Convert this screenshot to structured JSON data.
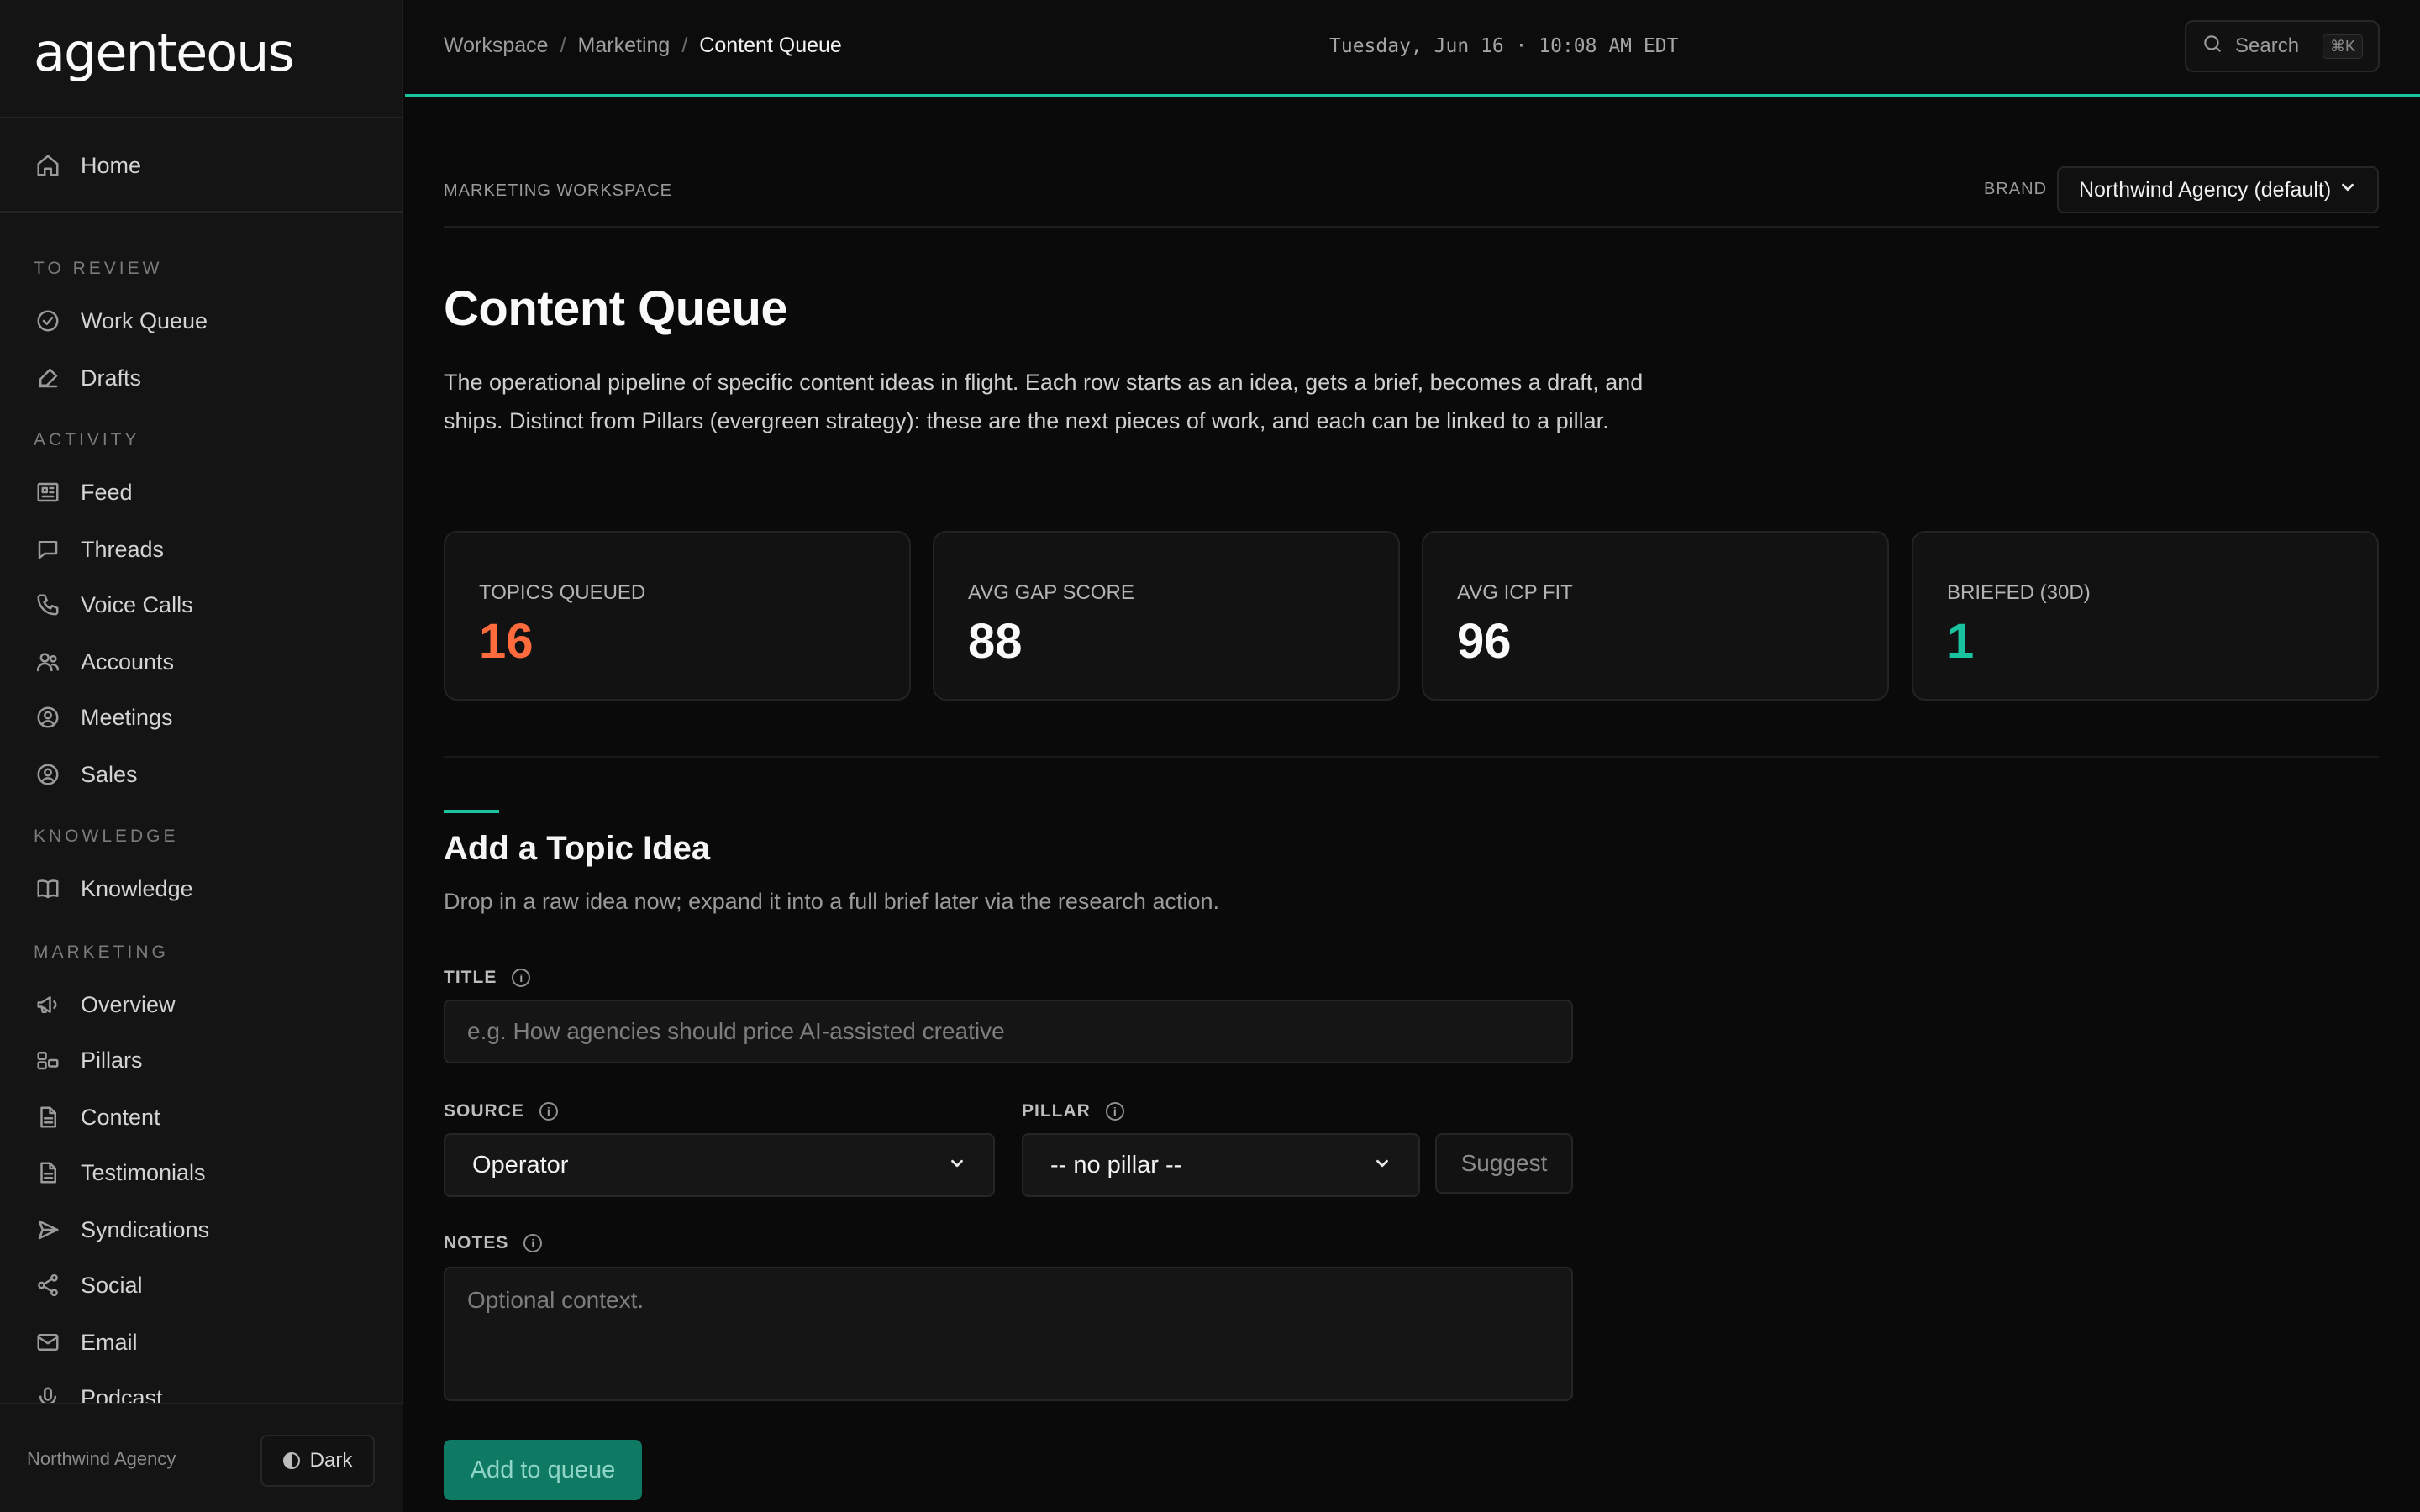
{
  "app": {
    "logo": "agenteous"
  },
  "colors": {
    "accent": "#19c3a0",
    "topics_value": "#ff6b3d",
    "briefed_value": "#19c3a0"
  },
  "sidebar": {
    "home": {
      "label": "Home",
      "icon": "home-icon"
    },
    "sections": [
      {
        "label": "TO REVIEW",
        "items": [
          {
            "label": "Work Queue",
            "icon": "check-circle-icon"
          },
          {
            "label": "Drafts",
            "icon": "edit-icon"
          }
        ]
      },
      {
        "label": "ACTIVITY",
        "items": [
          {
            "label": "Feed",
            "icon": "newspaper-icon"
          },
          {
            "label": "Threads",
            "icon": "chat-icon"
          },
          {
            "label": "Voice Calls",
            "icon": "phone-icon"
          },
          {
            "label": "Accounts",
            "icon": "users-icon"
          },
          {
            "label": "Meetings",
            "icon": "user-circle-icon"
          },
          {
            "label": "Sales",
            "icon": "user-circle-icon"
          }
        ]
      },
      {
        "label": "KNOWLEDGE",
        "items": [
          {
            "label": "Knowledge",
            "icon": "book-icon"
          }
        ]
      },
      {
        "label": "MARKETING",
        "items": [
          {
            "label": "Overview",
            "icon": "megaphone-icon"
          },
          {
            "label": "Pillars",
            "icon": "pillars-icon"
          },
          {
            "label": "Content",
            "icon": "document-icon"
          },
          {
            "label": "Testimonials",
            "icon": "document-icon"
          },
          {
            "label": "Syndications",
            "icon": "send-icon"
          },
          {
            "label": "Social",
            "icon": "share-icon"
          },
          {
            "label": "Email",
            "icon": "mail-icon"
          },
          {
            "label": "Podcast",
            "icon": "mic-icon"
          }
        ]
      }
    ],
    "footer": {
      "org": "Northwind Agency",
      "theme_label": "Dark"
    }
  },
  "topbar": {
    "breadcrumbs": [
      "Workspace",
      "Marketing",
      "Content Queue"
    ],
    "datetime": "Tuesday, Jun 16 · 10:08 AM EDT",
    "search_label": "Search",
    "search_shortcut": "⌘K"
  },
  "main": {
    "workspace_label": "MARKETING WORKSPACE",
    "brand_label": "BRAND",
    "brand_value": "Northwind Agency (default)",
    "title": "Content Queue",
    "description": "The operational pipeline of specific content ideas in flight. Each row starts as an idea, gets a brief, becomes a draft, and ships. Distinct from Pillars (evergreen strategy): these are the next pieces of work, and each can be linked to a pillar.",
    "stats": [
      {
        "label": "TOPICS QUEUED",
        "value": "16"
      },
      {
        "label": "AVG GAP SCORE",
        "value": "88"
      },
      {
        "label": "AVG ICP FIT",
        "value": "96"
      },
      {
        "label": "BRIEFED (30D)",
        "value": "1"
      }
    ],
    "form": {
      "title": "Add a Topic Idea",
      "subtitle": "Drop in a raw idea now; expand it into a full brief later via the research action.",
      "title_label": "TITLE",
      "title_placeholder": "e.g. How agencies should price AI-assisted creative",
      "source_label": "SOURCE",
      "source_value": "Operator",
      "pillar_label": "PILLAR",
      "pillar_value": "-- no pillar --",
      "suggest_label": "Suggest",
      "notes_label": "NOTES",
      "notes_placeholder": "Optional context.",
      "submit_label": "Add to queue"
    }
  }
}
